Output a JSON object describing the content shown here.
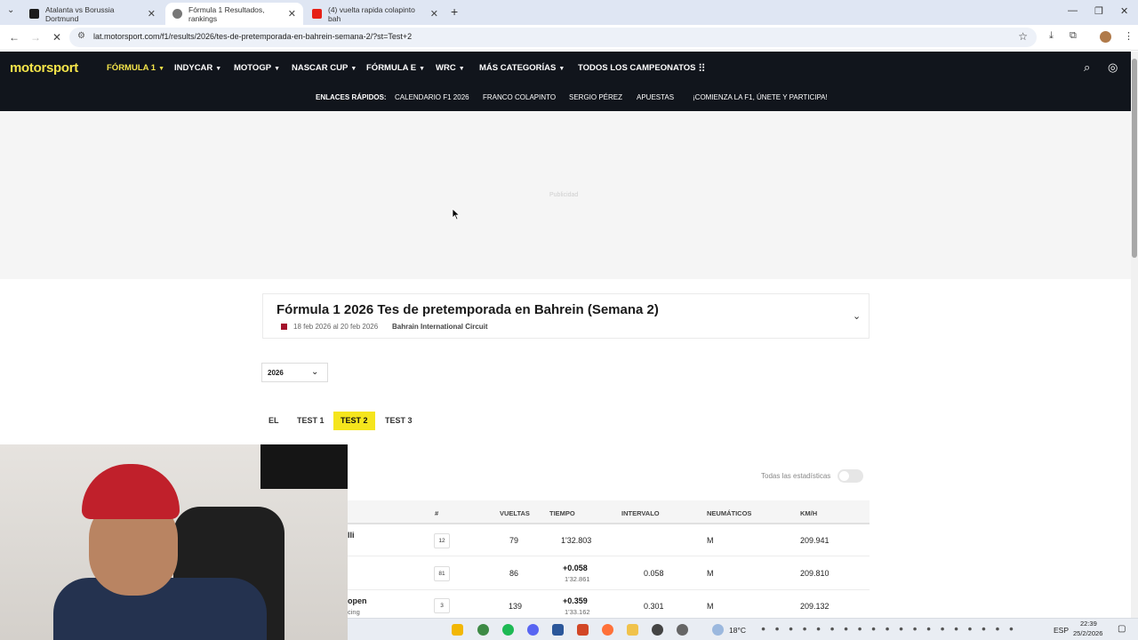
{
  "browser": {
    "tabs": [
      {
        "title": "Atalanta vs Borussia Dortmund",
        "active": false
      },
      {
        "title": "Fórmula 1 Resultados, rankings",
        "active": true
      },
      {
        "title": "(4) vuelta rapida colapinto bah",
        "active": false
      }
    ],
    "url": "lat.motorsport.com/f1/results/2026/tes-de-pretemporada-en-bahrein-semana-2/?st=Test+2"
  },
  "site": {
    "logo": "motorsport",
    "nav": [
      {
        "label": "FÓRMULA 1",
        "active": true
      },
      {
        "label": "INDYCAR",
        "active": false
      },
      {
        "label": "MOTOGP",
        "active": false
      },
      {
        "label": "NASCAR CUP",
        "active": false
      },
      {
        "label": "FÓRMULA E",
        "active": false
      },
      {
        "label": "WRC",
        "active": false
      },
      {
        "label": "MÁS CATEGORÍAS",
        "active": false
      }
    ],
    "all_championships": "TODOS LOS CAMPEONATOS",
    "quick_links_label": "ENLACES RÁPIDOS:",
    "quick_links": [
      "CALENDARIO F1 2026",
      "FRANCO COLAPINTO",
      "SERGIO PÉREZ",
      "APUESTAS",
      "¡COMIENZA LA F1, ÚNETE Y PARTICIPA!"
    ],
    "accent": "#f5e54a"
  },
  "ad": {
    "label": "Publicidad"
  },
  "event": {
    "title": "Fórmula 1 2026 Tes de pretemporada en Bahrein (Semana 2)",
    "dates": "18 feb 2026 al 20 feb 2026",
    "circuit": "Bahrain International Circuit"
  },
  "year_select": {
    "value": "2026"
  },
  "session_tabs": [
    {
      "label": "EL",
      "active": false
    },
    {
      "label": "TEST 1",
      "active": false
    },
    {
      "label": "TEST 2",
      "active": true
    },
    {
      "label": "TEST 3",
      "active": false
    }
  ],
  "all_stats_label": "Todas las estadísticas",
  "table": {
    "headers": {
      "number": "#",
      "laps": "VUELTAS",
      "time": "TIEMPO",
      "interval": "INTERVALO",
      "tyres": "NEUMÁTICOS",
      "speed": "KM/H"
    },
    "rows": [
      {
        "driver": "lli",
        "team": "",
        "number": "12",
        "laps": "79",
        "time": "1'32.803",
        "time_sub": "",
        "interval": "",
        "tyre": "M",
        "speed": "209.941"
      },
      {
        "driver": "",
        "team": "",
        "number": "81",
        "laps": "86",
        "time": "+0.058",
        "time_sub": "1'32.861",
        "interval": "0.058",
        "tyre": "M",
        "speed": "209.810"
      },
      {
        "driver": "open",
        "team": "cing",
        "number": "3",
        "laps": "139",
        "time": "+0.359",
        "time_sub": "1'33.162",
        "interval": "0.301",
        "tyre": "M",
        "speed": "209.132"
      }
    ]
  },
  "taskbar": {
    "weather": "18°C",
    "lang": "ESP",
    "time": "22:39",
    "date": "25/2/2026"
  }
}
